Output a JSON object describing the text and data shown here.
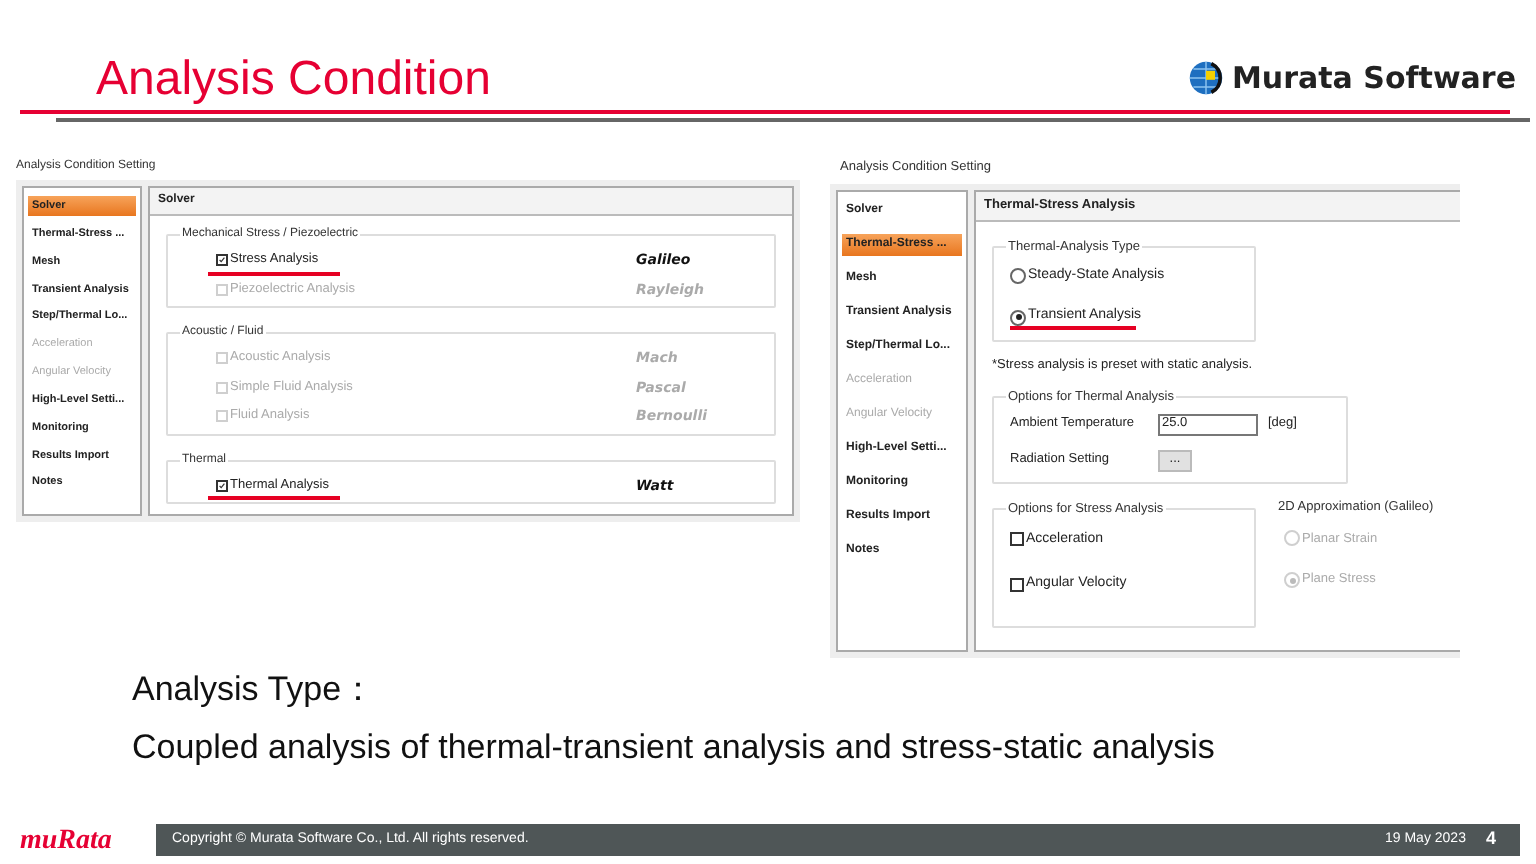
{
  "header": {
    "title": "Analysis Condition",
    "brand": "Murata Software"
  },
  "left_dialog": {
    "title": "Analysis Condition Setting",
    "sidebar": [
      {
        "label": "Solver",
        "selected": true,
        "disabled": false
      },
      {
        "label": "Thermal-Stress ...",
        "selected": false,
        "disabled": false
      },
      {
        "label": "Mesh",
        "selected": false,
        "disabled": false
      },
      {
        "label": "Transient Analysis",
        "selected": false,
        "disabled": false
      },
      {
        "label": "Step/Thermal Lo...",
        "selected": false,
        "disabled": false
      },
      {
        "label": "Acceleration",
        "selected": false,
        "disabled": true
      },
      {
        "label": "Angular Velocity",
        "selected": false,
        "disabled": true
      },
      {
        "label": "High-Level Setti...",
        "selected": false,
        "disabled": false
      },
      {
        "label": "Monitoring",
        "selected": false,
        "disabled": false
      },
      {
        "label": "Results Import",
        "selected": false,
        "disabled": false
      },
      {
        "label": "Notes",
        "selected": false,
        "disabled": false
      }
    ],
    "panel_title": "Solver",
    "groups": [
      {
        "title": "Mechanical Stress / Piezoelectric",
        "items": [
          {
            "label": "Stress Analysis",
            "checked": true,
            "disabled": false,
            "highlighted": true,
            "solver": "Galileo"
          },
          {
            "label": "Piezoelectric Analysis",
            "checked": false,
            "disabled": true,
            "highlighted": false,
            "solver": "Rayleigh"
          }
        ]
      },
      {
        "title": "Acoustic / Fluid",
        "items": [
          {
            "label": "Acoustic Analysis",
            "checked": false,
            "disabled": true,
            "highlighted": false,
            "solver": "Mach"
          },
          {
            "label": "Simple Fluid Analysis",
            "checked": false,
            "disabled": true,
            "highlighted": false,
            "solver": "Pascal"
          },
          {
            "label": "Fluid Analysis",
            "checked": false,
            "disabled": true,
            "highlighted": false,
            "solver": "Bernoulli"
          }
        ]
      },
      {
        "title": "Thermal",
        "items": [
          {
            "label": "Thermal Analysis",
            "checked": true,
            "disabled": false,
            "highlighted": true,
            "solver": "Watt"
          }
        ]
      }
    ]
  },
  "right_dialog": {
    "title": "Analysis Condition Setting",
    "sidebar": [
      {
        "label": "Solver",
        "selected": false,
        "disabled": false
      },
      {
        "label": "Thermal-Stress ...",
        "selected": true,
        "disabled": false
      },
      {
        "label": "Mesh",
        "selected": false,
        "disabled": false
      },
      {
        "label": "Transient Analysis",
        "selected": false,
        "disabled": false
      },
      {
        "label": "Step/Thermal Lo...",
        "selected": false,
        "disabled": false
      },
      {
        "label": "Acceleration",
        "selected": false,
        "disabled": true
      },
      {
        "label": "Angular Velocity",
        "selected": false,
        "disabled": true
      },
      {
        "label": "High-Level Setti...",
        "selected": false,
        "disabled": false
      },
      {
        "label": "Monitoring",
        "selected": false,
        "disabled": false
      },
      {
        "label": "Results Import",
        "selected": false,
        "disabled": false
      },
      {
        "label": "Notes",
        "selected": false,
        "disabled": false
      }
    ],
    "panel_title": "Thermal-Stress Analysis",
    "thermal_type": {
      "title": "Thermal-Analysis Type",
      "options": [
        {
          "label": "Steady-State Analysis",
          "selected": false,
          "highlighted": false
        },
        {
          "label": "Transient Analysis",
          "selected": true,
          "highlighted": true
        }
      ]
    },
    "note": "*Stress analysis is preset with static analysis.",
    "thermal_options": {
      "title": "Options for Thermal Analysis",
      "ambient_label": "Ambient Temperature",
      "ambient_value": "25.0",
      "unit": "[deg]",
      "radiation_label": "Radiation Setting",
      "radiation_button": "..."
    },
    "stress_options": {
      "title": "Options for Stress Analysis",
      "items": [
        {
          "label": "Acceleration",
          "checked": false
        },
        {
          "label": "Angular Velocity",
          "checked": false
        }
      ]
    },
    "approximation": {
      "title": "2D Approximation (Galileo)",
      "options": [
        {
          "label": "Planar Strain",
          "selected": false,
          "disabled": true
        },
        {
          "label": "Plane Stress",
          "selected": true,
          "disabled": true
        }
      ]
    }
  },
  "body": {
    "heading": "Analysis Type：",
    "text": "Coupled analysis of thermal-transient analysis and stress-static analysis"
  },
  "footer": {
    "logo": "muRata",
    "copyright": "Copyright © Murata Software Co., Ltd. All rights reserved.",
    "date": "19 May 2023",
    "page": "4"
  }
}
